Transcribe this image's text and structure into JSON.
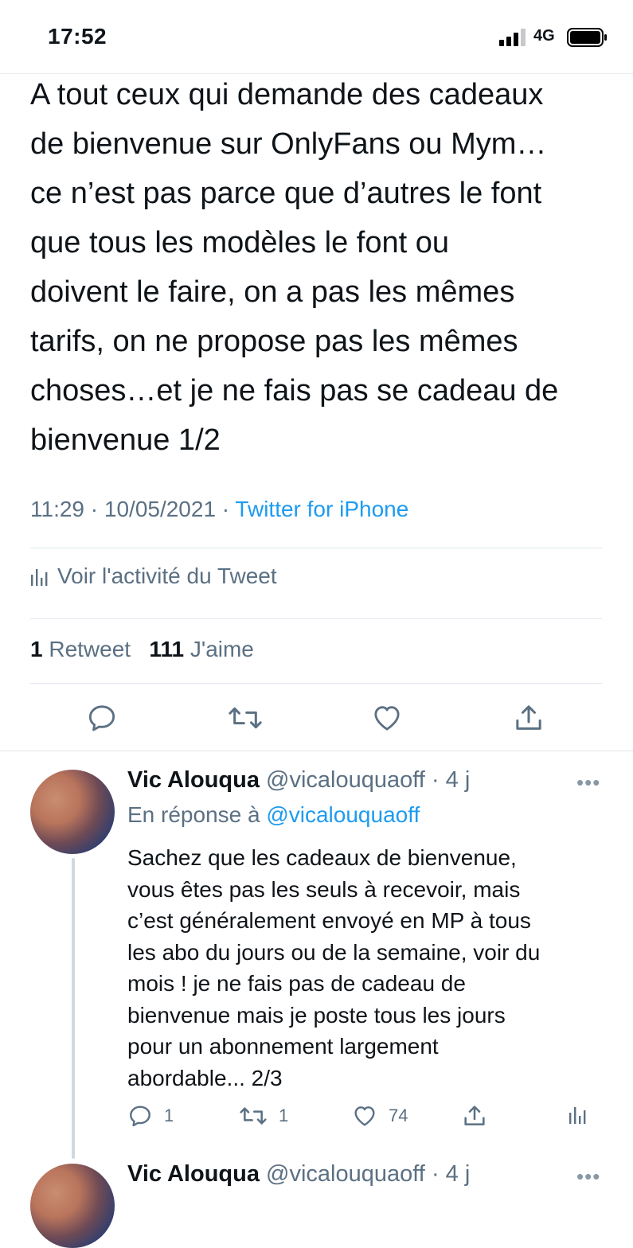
{
  "status_bar": {
    "time": "17:52",
    "network": "4G",
    "icons": [
      "signal-icon",
      "battery-icon"
    ]
  },
  "tweet": {
    "text": "A tout ceux qui demande des cadeaux\nde bienvenue sur OnlyFans ou Mym…\nce n’est pas parce que d’autres le font\nque tous les modèles le font ou\ndoivent le faire, on a pas les mêmes\ntarifs, on ne propose pas les mêmes\nchoses…et je ne fais pas se cadeau de\nbienvenue 1/2",
    "time": "11:29",
    "date": "10/05/2021",
    "separator": " · ",
    "source": "Twitter for iPhone",
    "activity_label": "Voir l'activité du Tweet",
    "retweet_count": "1",
    "retweet_label": "Retweet",
    "like_count": "111",
    "like_label": "J'aime",
    "actions": [
      "reply-icon",
      "retweet-icon",
      "like-icon",
      "share-icon"
    ]
  },
  "replies": [
    {
      "name": "Vic Alouqua",
      "handle": "@vicalouquaoff",
      "age": "· 4 j",
      "more": "•••",
      "in_reply_prefix": "En réponse à ",
      "in_reply_handle": "@vicalouquaoff",
      "text": "Sachez que les cadeaux de bienvenue,\nvous êtes pas les seuls à recevoir, mais\nc’est généralement envoyé en MP à tous\nles abo du jours ou de la semaine, voir du\nmois ! je ne fais pas de cadeau de\nbienvenue mais je poste tous les jours\npour un abonnement largement\nabordable... 2/3",
      "reply_count": "1",
      "retweet_count": "1",
      "like_count": "74"
    },
    {
      "name": "Vic Alouqua",
      "handle": "@vicalouquaoff",
      "age": "· 4 j",
      "more": "•••"
    }
  ],
  "colors": {
    "text": "#0f1419",
    "secondary": "#5b7083",
    "link": "#1d9bf0",
    "divider": "#e1e8ed"
  }
}
